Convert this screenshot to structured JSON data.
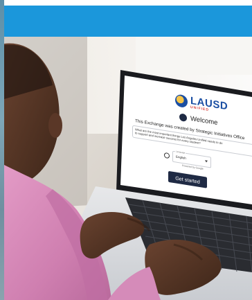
{
  "laptop_screen": {
    "logo_text": "LAUSD",
    "logo_subtext": "UNIFIED",
    "welcome": "Welcome",
    "intro": "This Exchange was created by Strategic Initiatives Office",
    "question_line1": "What are the most important things Los Angeles Unified needs to do",
    "question_line2": "to support and increase success for every student?",
    "language_label": "Language",
    "language_value": "English",
    "powered_by": "Powered by Google",
    "cta": "Get started"
  },
  "colors": {
    "banner": "#1b97db",
    "shirt": "#d98ab8",
    "button": "#1f2a44"
  }
}
